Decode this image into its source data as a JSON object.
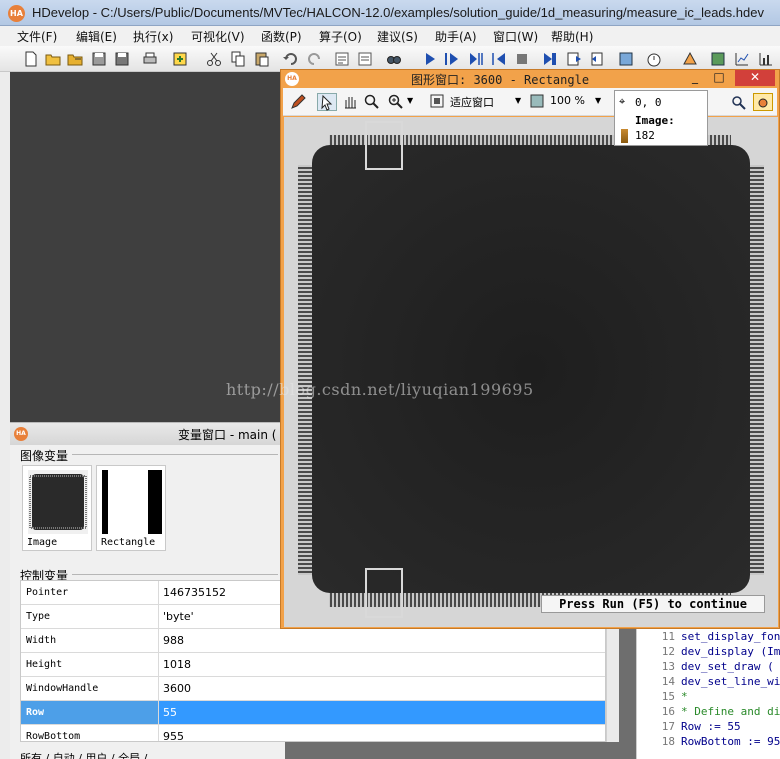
{
  "window": {
    "title": "HDevelop - C:/Users/Public/Documents/MVTec/HALCON-12.0/examples/solution_guide/1d_measuring/measure_ic_leads.hdev",
    "logo": "HA"
  },
  "menu": [
    "文件(F)",
    "编辑(E)",
    "执行(x)",
    "可视化(V)",
    "函数(P)",
    "算子(O)",
    "建议(S)",
    "助手(A)",
    "窗口(W)",
    "帮助(H)"
  ],
  "toolbar_icons": [
    "new-file-icon",
    "open-icon",
    "open-example-icon",
    "save-icon",
    "save-all-icon",
    "print-icon",
    "insert-icon",
    "cut-icon",
    "copy-icon",
    "paste-icon",
    "undo-icon",
    "redo-icon",
    "comment-icon",
    "uncomment-icon",
    "find-icon",
    "run-icon",
    "step-over-icon",
    "step-into-icon",
    "step-out-icon",
    "stop-icon",
    "reset-icon",
    "activate-icon",
    "deactivate-icon",
    "profiler-icon",
    "timer-icon",
    "help-icon",
    "image-acq-icon",
    "measure-icon",
    "calibration-icon"
  ],
  "graphics_window": {
    "logo": "HA",
    "title": "图形窗口: 3600 - Rectangle",
    "fit_label": "适应窗口",
    "zoom": "100 %",
    "coords": "0, 0",
    "pixel_label": "Image:",
    "pixel_value": "182",
    "run_banner": "Press Run (F5) to continue",
    "minimize": "_",
    "maximize": "□",
    "close": "✕",
    "lead_color": "#cfcfcf",
    "body_color": "#1c1c1c",
    "roi_color": "#d9d9d9"
  },
  "watermark": "http://blog.csdn.net/liyuqian199695",
  "variable_window": {
    "logo": "HA",
    "title": "变量窗口 - main (",
    "image_section": "图像变量",
    "control_section": "控制变量",
    "images": [
      {
        "name": "Image"
      },
      {
        "name": "Rectangle"
      }
    ],
    "controls": [
      {
        "name": "Pointer",
        "value": "146735152"
      },
      {
        "name": "Type",
        "value": "'byte'"
      },
      {
        "name": "Width",
        "value": "988"
      },
      {
        "name": "Height",
        "value": "1018"
      },
      {
        "name": "WindowHandle",
        "value": "3600"
      },
      {
        "name": "Row",
        "value": "55",
        "selected": true
      },
      {
        "name": "RowBottom",
        "value": "955"
      }
    ],
    "tabs": "所有 / 自动 / 用户 / 全局 /"
  },
  "editor_lines": [
    {
      "num": "11",
      "code": "set_display_font"
    },
    {
      "num": "12",
      "code": "dev_display (Im"
    },
    {
      "num": "13",
      "code": "dev_set_draw ("
    },
    {
      "num": "14",
      "code": "dev_set_line_wi"
    },
    {
      "num": "15",
      "code": "*",
      "comment": true
    },
    {
      "num": "16",
      "code": "* Define and di",
      "comment": true
    },
    {
      "num": "17",
      "code": "Row := 55"
    },
    {
      "num": "18",
      "code": "RowBottom := 95"
    }
  ]
}
